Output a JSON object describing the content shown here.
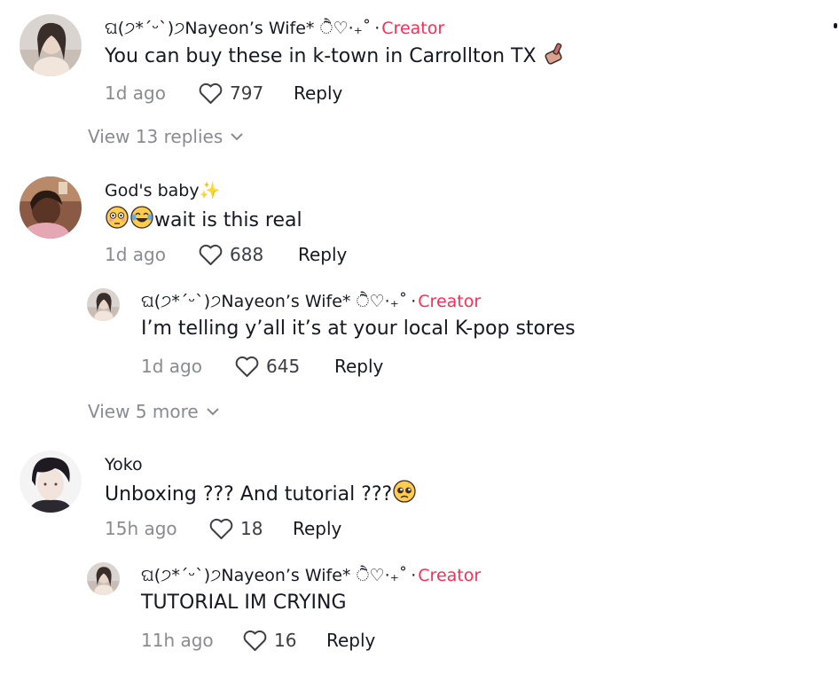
{
  "comments": [
    {
      "author": "ଘ(੭*ˊᵕˋ)੭Nayeon’s Wife* ੈ♡‧₊˚",
      "creator_label": "Creator",
      "text": "You can buy these in k-town in Carrollton TX",
      "emoji_tail": "💅",
      "time": "1d ago",
      "likes": "797",
      "reply": "Reply",
      "view_replies": "View 13 replies"
    },
    {
      "author": "God's baby✨",
      "text": "wait is this real",
      "emoji_lead": "😳😂",
      "time": "1d ago",
      "likes": "688",
      "reply": "Reply",
      "reply_item": {
        "author": "ଘ(੭*ˊᵕˋ)੭Nayeon’s Wife* ੈ♡‧₊˚",
        "creator_label": "Creator",
        "text": "I’m telling y’all it’s at your local K-pop stores",
        "time": "1d ago",
        "likes": "645",
        "reply": "Reply"
      },
      "view_more": "View 5 more"
    },
    {
      "author": "Yoko",
      "text": "Unboxing ??? And tutorial ???",
      "emoji_tail": "🥺",
      "time": "15h ago",
      "likes": "18",
      "reply": "Reply",
      "reply_item": {
        "author": "ଘ(੭*ˊᵕˋ)੭Nayeon’s Wife* ੈ♡‧₊˚",
        "creator_label": "Creator",
        "text": "TUTORIAL IM CRYING",
        "time": "11h ago",
        "likes": "16",
        "reply": "Reply"
      }
    }
  ],
  "icons": {
    "like": "heart-outline-icon",
    "chevron": "chevron-down-icon"
  },
  "colors": {
    "creator": "#fe2c55",
    "muted": "#8a8b91",
    "text": "#161823"
  }
}
